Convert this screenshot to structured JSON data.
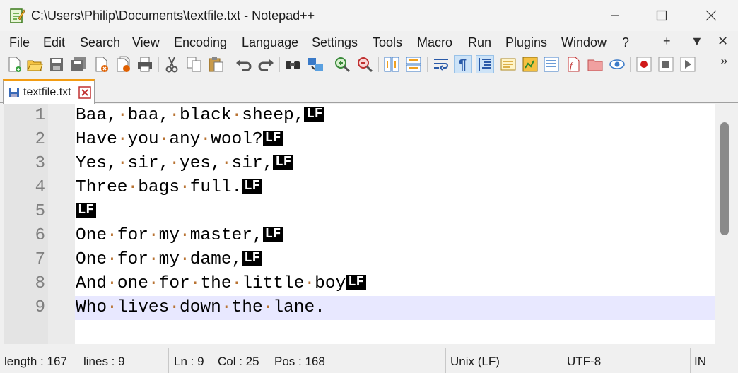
{
  "window": {
    "title": "C:\\Users\\Philip\\Documents\\textfile.txt - Notepad++",
    "minimize_icon": "minimize-icon",
    "maximize_icon": "maximize-icon",
    "close_icon": "close-icon"
  },
  "menubar": {
    "items": [
      "File",
      "Edit",
      "Search",
      "View",
      "Encoding",
      "Language",
      "Settings",
      "Tools",
      "Macro",
      "Run",
      "Plugins",
      "Window",
      "?"
    ],
    "right_items": [
      "+",
      "▼",
      "✕"
    ]
  },
  "toolbar": {
    "buttons": [
      "new-file-icon",
      "open-file-icon",
      "save-icon",
      "save-all-icon",
      "close-icon",
      "close-all-icon",
      "print-icon",
      "cut-icon",
      "copy-icon",
      "paste-icon",
      "undo-icon",
      "redo-icon",
      "find-icon",
      "replace-icon",
      "zoom-in-icon",
      "zoom-out-icon",
      "sync-vertical-icon",
      "sync-horizontal-icon",
      "word-wrap-icon",
      "show-all-characters-icon",
      "indent-guide-icon",
      "define-language-icon",
      "document-map-icon",
      "function-list-icon",
      "folder-as-workspace-icon",
      "monitoring-icon",
      "record-macro-icon",
      "stop-recording-icon",
      "playback-macro-icon"
    ],
    "active_button": "show-all-characters-icon",
    "overflow": "»"
  },
  "tabs": [
    {
      "label": "textfile.txt",
      "icon": "saved-file-icon",
      "close_icon": "tab-close-icon"
    }
  ],
  "editor": {
    "eol_marker": "LF",
    "current_line": 9,
    "lines": [
      {
        "number": "1",
        "text": "Baa, baa, black sheep,",
        "eol": true
      },
      {
        "number": "2",
        "text": "Have you any wool?",
        "eol": true
      },
      {
        "number": "3",
        "text": "Yes, sir, yes, sir,",
        "eol": true
      },
      {
        "number": "4",
        "text": "Three bags full.",
        "eol": true
      },
      {
        "number": "5",
        "text": "",
        "eol": true
      },
      {
        "number": "6",
        "text": "One for my master,",
        "eol": true
      },
      {
        "number": "7",
        "text": "One for my dame,",
        "eol": true
      },
      {
        "number": "8",
        "text": "And one for the little boy",
        "eol": true
      },
      {
        "number": "9",
        "text": "Who lives down the lane.",
        "eol": false
      }
    ]
  },
  "statusbar": {
    "length": "length : 167",
    "lines": "lines : 9",
    "ln": "Ln : 9",
    "col": "Col : 25",
    "pos": "Pos : 168",
    "eol_format": "Unix (LF)",
    "encoding": "UTF-8",
    "mode": "IN"
  },
  "colors": {
    "current_line_bg": "#e8e8ff",
    "tab_accent": "#f39c12",
    "whitespace_dot": "#b87333"
  }
}
